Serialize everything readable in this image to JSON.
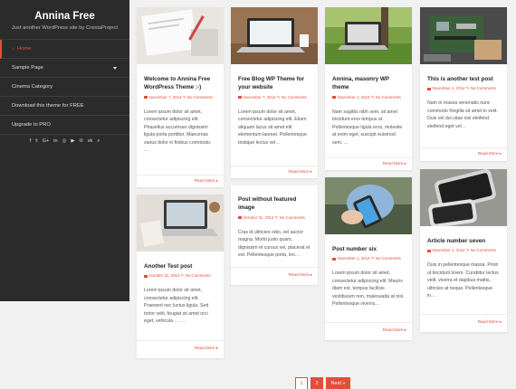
{
  "site": {
    "title": "Annina Free",
    "description": "Just another WordPress site by CrestaProject"
  },
  "menu": [
    {
      "label": "Home",
      "active": true
    },
    {
      "label": "Sample Page",
      "has_children": true
    },
    {
      "label": "Cinema Category"
    },
    {
      "label": "Download this theme for FREE"
    },
    {
      "label": "Upgrade to PRO"
    }
  ],
  "social_icons": [
    {
      "name": "facebook-icon",
      "glyph": "f"
    },
    {
      "name": "twitter-icon",
      "glyph": "𝕥"
    },
    {
      "name": "google-plus-icon",
      "glyph": "G+"
    },
    {
      "name": "linkedin-icon",
      "glyph": "in"
    },
    {
      "name": "instagram-icon",
      "glyph": "◎"
    },
    {
      "name": "youtube-icon",
      "glyph": "▶"
    },
    {
      "name": "pinterest-icon",
      "glyph": "℗"
    },
    {
      "name": "vk-icon",
      "glyph": "vk"
    },
    {
      "name": "search-icon",
      "glyph": "⌕"
    }
  ],
  "posts": [
    {
      "title": "Welcome to Annina Free WordPress Theme :-)",
      "date": "November 7, 2014",
      "comments": "No Comments",
      "excerpt": "Lorem ipsum dolor sit amet, consectetur adipiscing elit. Phasellus accumsan dignissim ligula porta porttitor. Maecenas varius dolor in finibus commodo. …",
      "read_more": "Read More ▸"
    },
    {
      "title": "Free Blog WP Theme for your website",
      "date": "November 7, 2014",
      "comments": "No Comments",
      "excerpt": "Lorem ipsum dolor sit amet, consectetur adipiscing elit. Etiam aliquam lacus sit amet elit elementum laoreet. Pellentesque tristique lectus vel…",
      "read_more": "Read More ▸"
    },
    {
      "title": "Annina, masonry WP theme",
      "date": "November 1, 2014",
      "comments": "No Comments",
      "excerpt": "Nam sagittis nibh sem, sit amet tincidunt eros tempus ut. Pellentesque ligula eros, molestie at enim eget, suscipit euismod sem. …",
      "read_more": "Read More ▸"
    },
    {
      "title": "This is another test post",
      "date": "November 1, 2014",
      "comments": "No Comments",
      "excerpt": "Nam in massa venenatis nunc commodo fringilla sit amet in velit. Duis vel dui vitae nisi eleifend eleifend eget vel…",
      "read_more": "Read More ▸"
    },
    {
      "title": "Another Test post",
      "date": "October 31, 2014",
      "comments": "No Comments",
      "excerpt": "Lorem ipsum dolor sit amet, consectetur adipiscing elit. Praesent nec luctus ligula. Sed tortor velit, feugiat sit amet orci eget, vehicula … …",
      "read_more": "Read More ▸"
    },
    {
      "title": "Post without featured image",
      "date": "October 31, 2014",
      "comments": "No Comments",
      "excerpt": "Cras id ultricies odio, vel auctor magna. Morbi justo quam, dignissim et cursus vel, placerat et est. Pellentesque porta, leo…",
      "read_more": "Read More ▸"
    },
    {
      "title": "Post number six",
      "date": "November 1, 2014",
      "comments": "No Comments",
      "excerpt": "Lorem ipsum dolor sit amet, consectetur adipiscing elit. Mauris diam est, tempus facilisis vestibulum non, malesuada at nisi. Pellentesque viverra…",
      "read_more": "Read More ▸"
    },
    {
      "title": "Article number seven",
      "date": "November 1, 2014",
      "comments": "No Comments",
      "excerpt": "Duis in pellentesque massa. Proin ut tincidunt lorem. Curabitur lectus velit, viverra et dapibus mattis, ultricies at neque. Pellentesque in…",
      "read_more": "Read More ▸"
    }
  ],
  "pagination": {
    "current": "1",
    "page2": "2",
    "next": "Next »"
  },
  "colors": {
    "accent": "#e24e3b",
    "sidebar": "#2b2b2b",
    "background": "#f1f1f1"
  }
}
